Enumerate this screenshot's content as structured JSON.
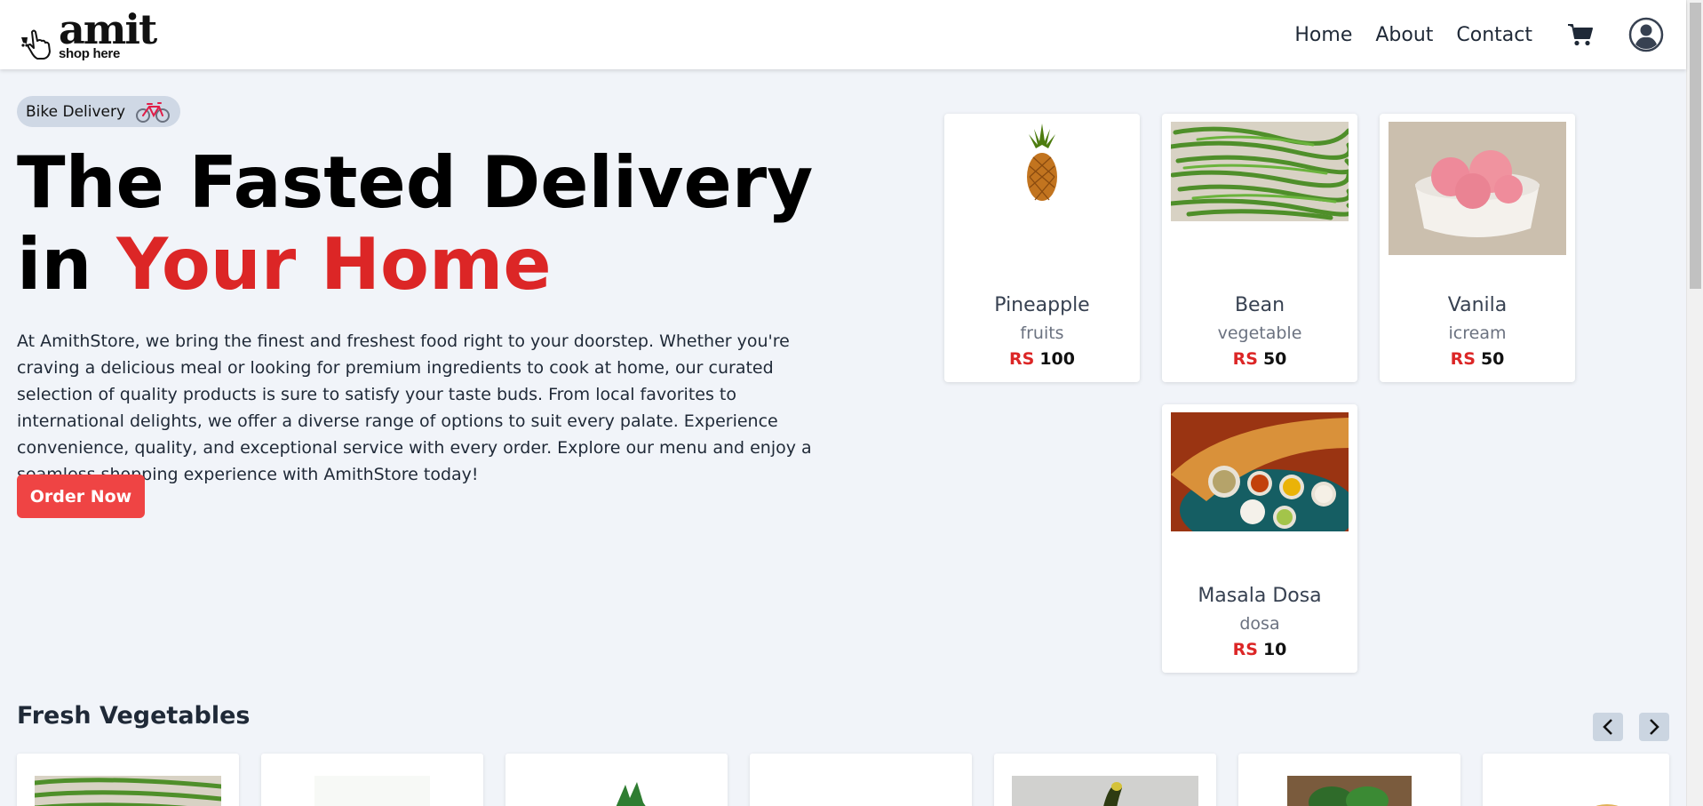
{
  "header": {
    "logo_word": "amit",
    "logo_tagline": "shop here",
    "nav": [
      "Home",
      "About",
      "Contact"
    ]
  },
  "hero": {
    "badge": "Bike Delivery",
    "title_line1": "The Fasted Delivery",
    "title_in": "in",
    "title_accent": "Your Home",
    "description": "At AmithStore, we bring the finest and freshest food right to your doorstep. Whether you're craving a delicious meal or looking for premium ingredients to cook at home, our curated selection of quality products is sure to satisfy your taste buds. From local favorites to international delights, we offer a diverse range of options to suit every palate. Experience convenience, quality, and exceptional service with every order. Explore our menu and enjoy a seamless shopping experience with AmithStore today!",
    "order_button": "Order Now"
  },
  "products": [
    {
      "name": "Pineapple",
      "category": "fruits",
      "currency": "RS",
      "price": "100"
    },
    {
      "name": "Bean",
      "category": "vegetable",
      "currency": "RS",
      "price": "50"
    },
    {
      "name": "Vanila",
      "category": "icream",
      "currency": "RS",
      "price": "50"
    },
    {
      "name": "Masala Dosa",
      "category": "dosa",
      "currency": "RS",
      "price": "10"
    }
  ],
  "fresh_vegetables": {
    "title": "Fresh Vegetables"
  },
  "colors": {
    "accent": "#dc2626",
    "button": "#ef4444",
    "background": "#f1f4f9"
  }
}
